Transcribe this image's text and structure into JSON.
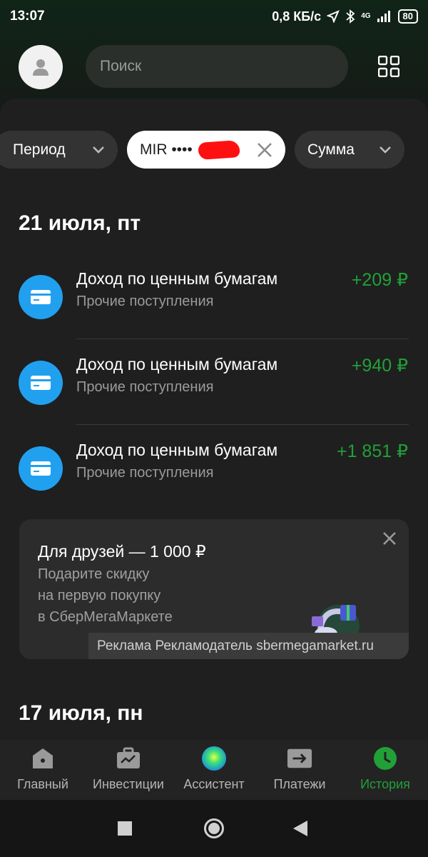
{
  "status_bar": {
    "time": "13:07",
    "network_speed": "0,8 КБ/с",
    "network_type": "4G",
    "battery": "80"
  },
  "header": {
    "search_placeholder": "Поиск",
    "avatar_icon": "user-icon",
    "menu_icon": "grid-icon"
  },
  "filters": {
    "period": "Период",
    "card": "MIR ••••",
    "amount": "Сумма"
  },
  "sections": [
    {
      "date": "21 июля, пт",
      "transactions": [
        {
          "title": "Доход по ценным бумагам",
          "category": "Прочие поступления",
          "amount": "+209 ₽"
        },
        {
          "title": "Доход по ценным бумагам",
          "category": "Прочие поступления",
          "amount": "+940 ₽"
        },
        {
          "title": "Доход по ценным бумагам",
          "category": "Прочие поступления",
          "amount": "+1 851 ₽"
        }
      ]
    },
    {
      "date": "17 июля, пн",
      "transactions": []
    }
  ],
  "promo": {
    "title": "Для друзей — 1 000 ₽",
    "lines": [
      "Подарите скидку",
      "на первую покупку",
      "в СберМегаМаркете"
    ],
    "ad_label": "Реклама Рекламодатель sbermegamarket.ru"
  },
  "bottom_nav": [
    {
      "label": "Главный",
      "icon": "home-icon",
      "active": false
    },
    {
      "label": "Инвестиции",
      "icon": "briefcase-chart-icon",
      "active": false
    },
    {
      "label": "Ассистент",
      "icon": "assistant-orb-icon",
      "active": false
    },
    {
      "label": "Платежи",
      "icon": "transfer-arrow-icon",
      "active": false
    },
    {
      "label": "История",
      "icon": "clock-icon",
      "active": true
    }
  ],
  "colors": {
    "background": "#1f1f1f",
    "accent_green": "#21a038",
    "icon_blue": "#21a0f0",
    "redaction": "#ff1010"
  }
}
